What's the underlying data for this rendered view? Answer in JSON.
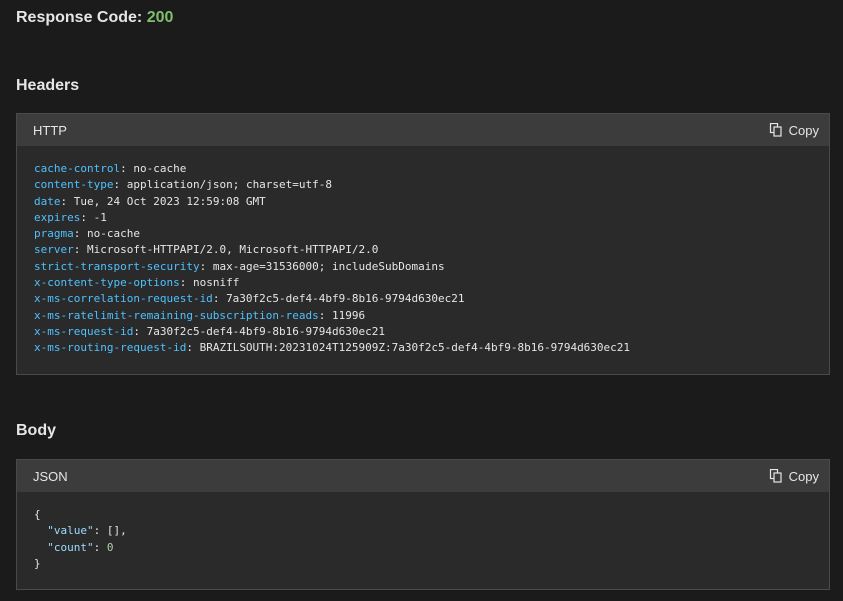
{
  "response": {
    "label": "Response Code:",
    "code": "200"
  },
  "headers_section": {
    "title": "Headers",
    "language": "HTTP",
    "copy_label": "Copy",
    "entries": [
      {
        "key": "cache-control",
        "value": "no-cache"
      },
      {
        "key": "content-type",
        "value": "application/json; charset=utf-8"
      },
      {
        "key": "date",
        "value": "Tue, 24 Oct 2023 12:59:08 GMT"
      },
      {
        "key": "expires",
        "value": "-1"
      },
      {
        "key": "pragma",
        "value": "no-cache"
      },
      {
        "key": "server",
        "value": "Microsoft-HTTPAPI/2.0, Microsoft-HTTPAPI/2.0"
      },
      {
        "key": "strict-transport-security",
        "value": "max-age=31536000; includeSubDomains"
      },
      {
        "key": "x-content-type-options",
        "value": "nosniff"
      },
      {
        "key": "x-ms-correlation-request-id",
        "value": "7a30f2c5-def4-4bf9-8b16-9794d630ec21"
      },
      {
        "key": "x-ms-ratelimit-remaining-subscription-reads",
        "value": "11996"
      },
      {
        "key": "x-ms-request-id",
        "value": "7a30f2c5-def4-4bf9-8b16-9794d630ec21"
      },
      {
        "key": "x-ms-routing-request-id",
        "value": "BRAZILSOUTH:20231024T125909Z:7a30f2c5-def4-4bf9-8b16-9794d630ec21"
      }
    ]
  },
  "body_section": {
    "title": "Body",
    "language": "JSON",
    "copy_label": "Copy",
    "lines": {
      "open": "{",
      "value_key": "\"value\"",
      "value_val": "[],",
      "count_key": "\"count\"",
      "count_val": "0",
      "close": "}"
    }
  },
  "icons": {
    "copy": "copy-icon"
  }
}
